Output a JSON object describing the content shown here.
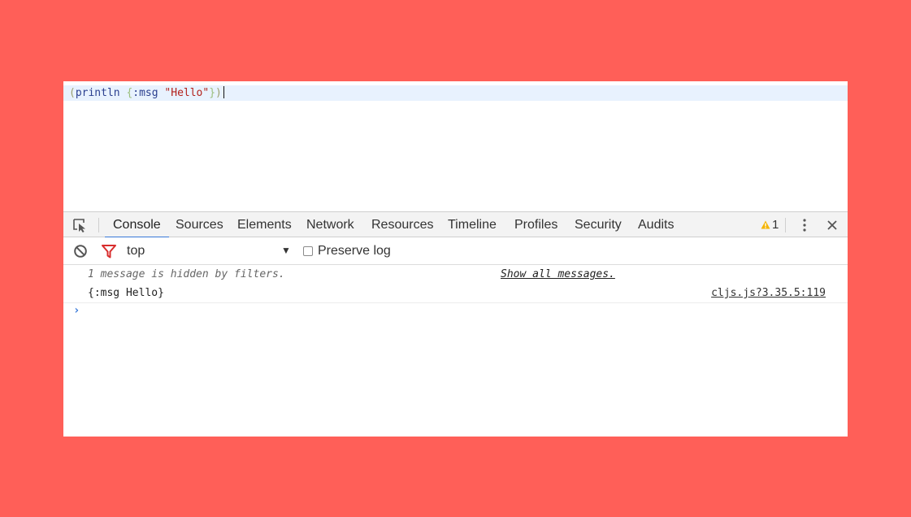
{
  "editor": {
    "tokens": {
      "open_paren": "(",
      "fn": "println",
      "space1": " ",
      "open_brace": "{",
      "kw": ":msg",
      "space2": " ",
      "str": "\"Hello\"",
      "close_brace": "}",
      "close_paren": ")"
    }
  },
  "tabs": [
    {
      "label": "Console",
      "active": true
    },
    {
      "label": "Sources"
    },
    {
      "label": "Elements"
    },
    {
      "label": "Network"
    },
    {
      "label": "Resources"
    },
    {
      "label": "Timeline"
    },
    {
      "label": "Profiles"
    },
    {
      "label": "Security"
    },
    {
      "label": "Audits"
    }
  ],
  "warnings": {
    "count": "1"
  },
  "toolbar": {
    "context": "top",
    "context_arrow": "▼",
    "preserve_log_label": "Preserve log"
  },
  "messages": {
    "hidden_text": "1 message is hidden by filters.",
    "show_all_link": "Show all messages.",
    "log_text": "{:msg Hello}",
    "log_source": "cljs.js?3.35.5:119"
  },
  "prompt_symbol": "›",
  "colors": {
    "background": "#ff5f58",
    "accent": "#3879d9",
    "filter_red": "#d82d2d",
    "warning_yellow": "#f4b400"
  }
}
